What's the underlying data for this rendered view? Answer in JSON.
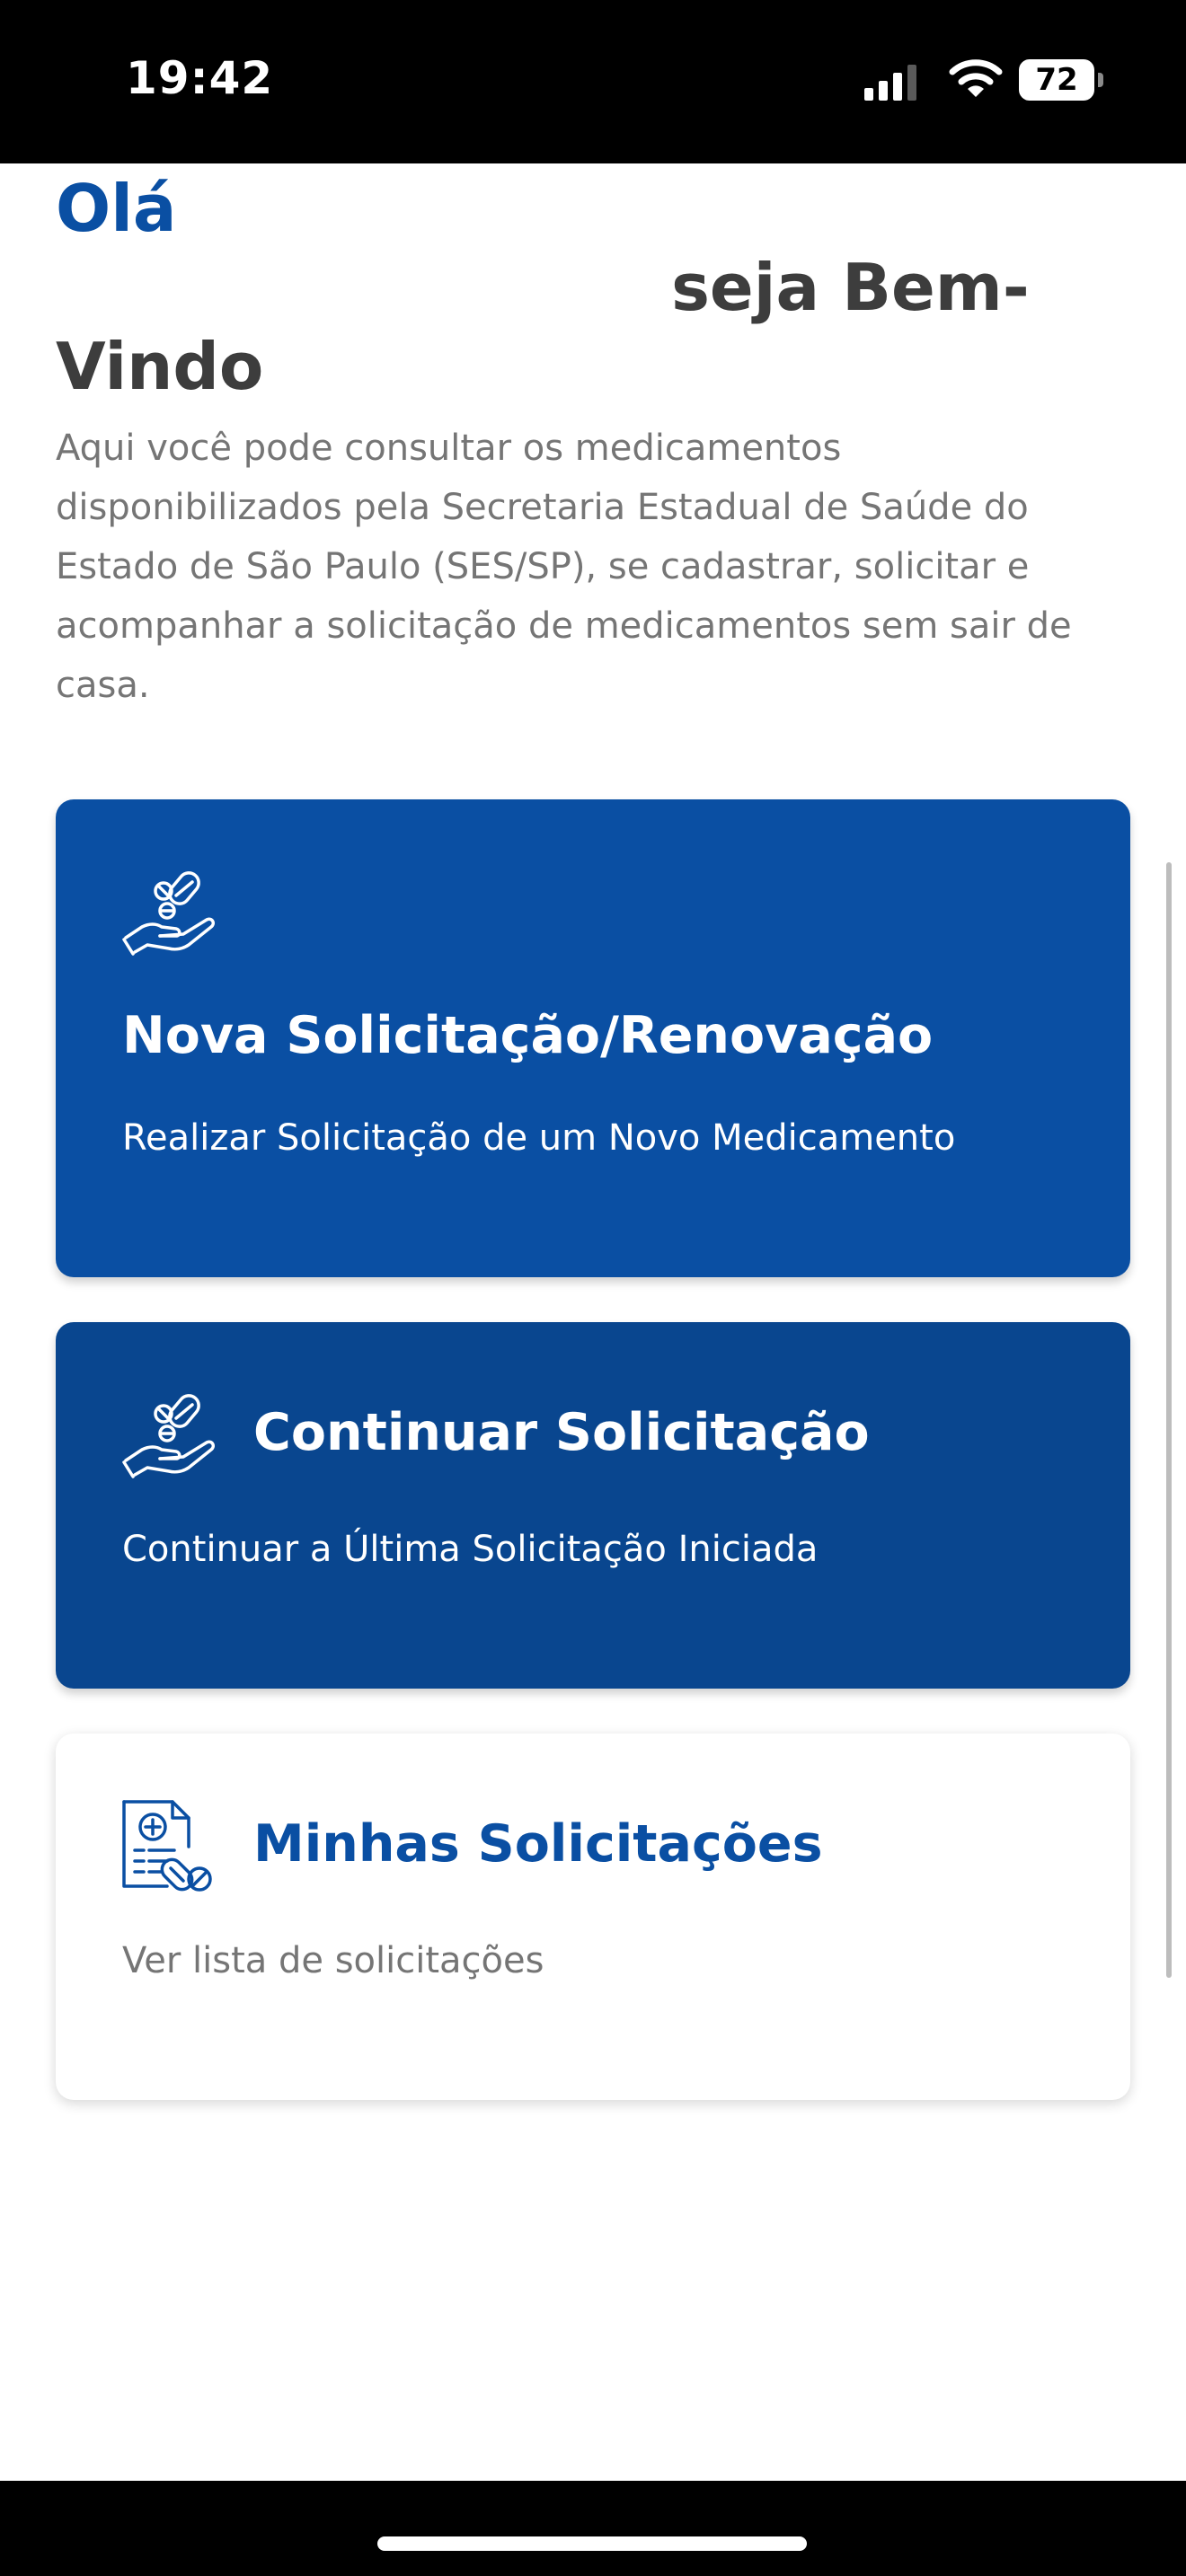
{
  "status_bar": {
    "time": "19:42",
    "battery": "72",
    "icons": [
      "signal-icon",
      "wifi-icon",
      "battery-icon"
    ]
  },
  "greeting": {
    "hello": "Olá",
    "welcome": "seja Bem-Vindo",
    "intro": "Aqui você pode consultar os medicamentos disponibilizados pela Secretaria Estadual de Saúde do Estado de São Paulo (SES/SP), se cadastrar, solicitar e acompanhar a solicitação de medicamentos sem sair de casa."
  },
  "cards": {
    "nova": {
      "title": "Nova Solicitação/Renovação",
      "subtitle": "Realizar Solicitação de um Novo Medicamento",
      "icon": "hand-pills-icon"
    },
    "continuar": {
      "title": "Continuar Solicitação",
      "subtitle": "Continuar a Última Solicitação Iniciada",
      "icon": "hand-pills-icon"
    },
    "minhas": {
      "title": "Minhas Solicitações",
      "subtitle": "Ver lista de solicitações",
      "icon": "prescription-document-icon"
    }
  },
  "colors": {
    "primary_blue": "#0a4fa3",
    "card_dark_blue": "#09468f",
    "text_dark": "#3d3d3d",
    "text_gray": "#757575"
  }
}
